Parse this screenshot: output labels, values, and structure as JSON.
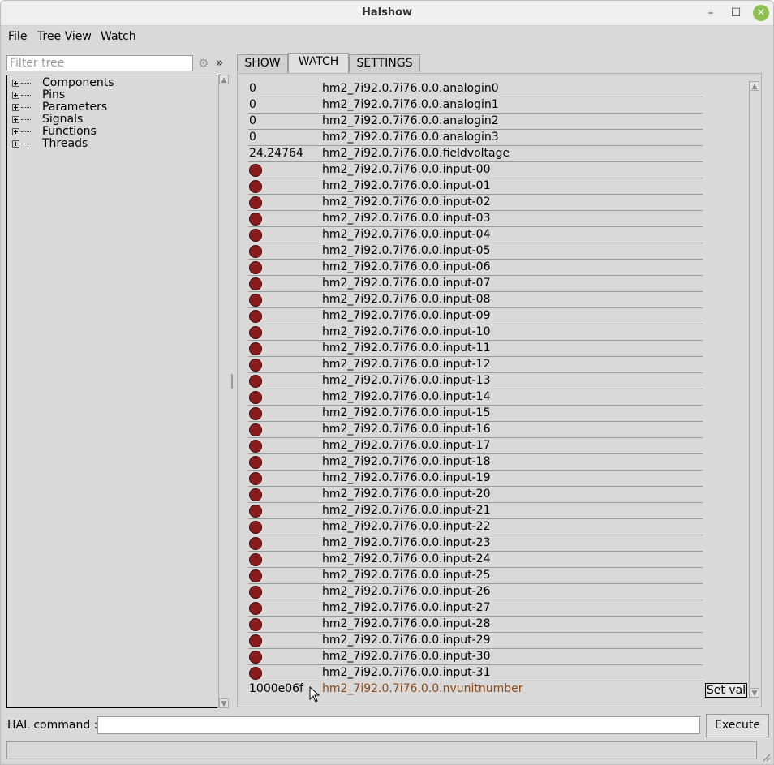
{
  "window": {
    "title": "Halshow",
    "minimize_glyph": "–",
    "maximize_glyph": "☐",
    "close_glyph": "×"
  },
  "menu": [
    "File",
    "Tree View",
    "Watch"
  ],
  "filter": {
    "placeholder": "Filter tree",
    "gear_icon": "⚙",
    "expand_icon": "»"
  },
  "tree": {
    "items": [
      "Components",
      "Pins",
      "Parameters",
      "Signals",
      "Functions",
      "Threads"
    ]
  },
  "tabs": [
    {
      "label": "SHOW",
      "active": false
    },
    {
      "label": "WATCH",
      "active": true
    },
    {
      "label": "SETTINGS",
      "active": false
    }
  ],
  "watch": {
    "rows": [
      {
        "kind": "value",
        "value": "0",
        "name": "hm2_7i92.0.7i76.0.0.analogin0"
      },
      {
        "kind": "value",
        "value": "0",
        "name": "hm2_7i92.0.7i76.0.0.analogin1"
      },
      {
        "kind": "value",
        "value": "0",
        "name": "hm2_7i92.0.7i76.0.0.analogin2"
      },
      {
        "kind": "value",
        "value": "0",
        "name": "hm2_7i92.0.7i76.0.0.analogin3"
      },
      {
        "kind": "value",
        "value": "24.24764",
        "name": "hm2_7i92.0.7i76.0.0.fieldvoltage"
      },
      {
        "kind": "led",
        "name": "hm2_7i92.0.7i76.0.0.input-00"
      },
      {
        "kind": "led",
        "name": "hm2_7i92.0.7i76.0.0.input-01"
      },
      {
        "kind": "led",
        "name": "hm2_7i92.0.7i76.0.0.input-02"
      },
      {
        "kind": "led",
        "name": "hm2_7i92.0.7i76.0.0.input-03"
      },
      {
        "kind": "led",
        "name": "hm2_7i92.0.7i76.0.0.input-04"
      },
      {
        "kind": "led",
        "name": "hm2_7i92.0.7i76.0.0.input-05"
      },
      {
        "kind": "led",
        "name": "hm2_7i92.0.7i76.0.0.input-06"
      },
      {
        "kind": "led",
        "name": "hm2_7i92.0.7i76.0.0.input-07"
      },
      {
        "kind": "led",
        "name": "hm2_7i92.0.7i76.0.0.input-08"
      },
      {
        "kind": "led",
        "name": "hm2_7i92.0.7i76.0.0.input-09"
      },
      {
        "kind": "led",
        "name": "hm2_7i92.0.7i76.0.0.input-10"
      },
      {
        "kind": "led",
        "name": "hm2_7i92.0.7i76.0.0.input-11"
      },
      {
        "kind": "led",
        "name": "hm2_7i92.0.7i76.0.0.input-12"
      },
      {
        "kind": "led",
        "name": "hm2_7i92.0.7i76.0.0.input-13"
      },
      {
        "kind": "led",
        "name": "hm2_7i92.0.7i76.0.0.input-14"
      },
      {
        "kind": "led",
        "name": "hm2_7i92.0.7i76.0.0.input-15"
      },
      {
        "kind": "led",
        "name": "hm2_7i92.0.7i76.0.0.input-16"
      },
      {
        "kind": "led",
        "name": "hm2_7i92.0.7i76.0.0.input-17"
      },
      {
        "kind": "led",
        "name": "hm2_7i92.0.7i76.0.0.input-18"
      },
      {
        "kind": "led",
        "name": "hm2_7i92.0.7i76.0.0.input-19"
      },
      {
        "kind": "led",
        "name": "hm2_7i92.0.7i76.0.0.input-20"
      },
      {
        "kind": "led",
        "name": "hm2_7i92.0.7i76.0.0.input-21"
      },
      {
        "kind": "led",
        "name": "hm2_7i92.0.7i76.0.0.input-22"
      },
      {
        "kind": "led",
        "name": "hm2_7i92.0.7i76.0.0.input-23"
      },
      {
        "kind": "led",
        "name": "hm2_7i92.0.7i76.0.0.input-24"
      },
      {
        "kind": "led",
        "name": "hm2_7i92.0.7i76.0.0.input-25"
      },
      {
        "kind": "led",
        "name": "hm2_7i92.0.7i76.0.0.input-26"
      },
      {
        "kind": "led",
        "name": "hm2_7i92.0.7i76.0.0.input-27"
      },
      {
        "kind": "led",
        "name": "hm2_7i92.0.7i76.0.0.input-28"
      },
      {
        "kind": "led",
        "name": "hm2_7i92.0.7i76.0.0.input-29"
      },
      {
        "kind": "led",
        "name": "hm2_7i92.0.7i76.0.0.input-30"
      },
      {
        "kind": "led",
        "name": "hm2_7i92.0.7i76.0.0.input-31"
      },
      {
        "kind": "param",
        "value": "1000e06f",
        "name": "hm2_7i92.0.7i76.0.0.nvunitnumber"
      }
    ],
    "set_val_label": "Set val",
    "led_color": "#8b1a1a",
    "param_color": "#8a4a16"
  },
  "hal_command": {
    "label": "HAL command :",
    "value": "",
    "execute_label": "Execute"
  },
  "status": {
    "text": ""
  }
}
